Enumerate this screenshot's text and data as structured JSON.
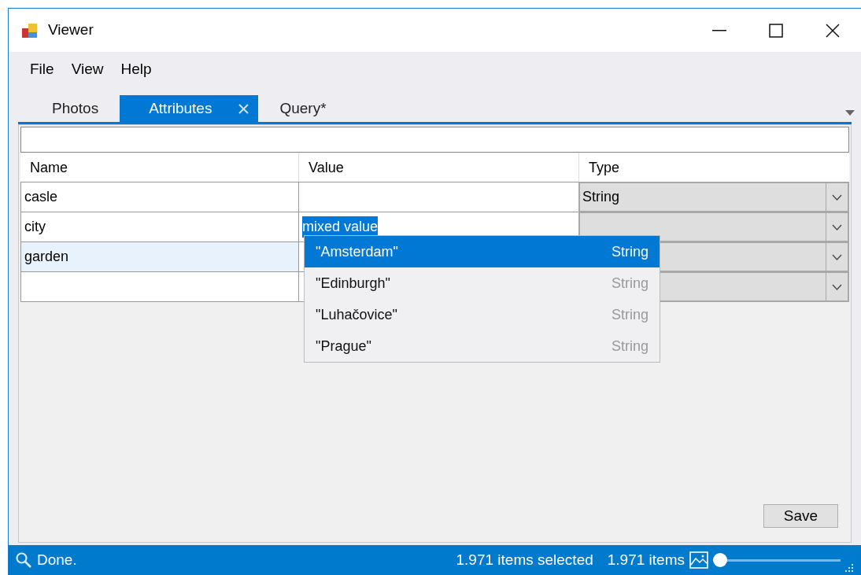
{
  "window": {
    "title": "Viewer"
  },
  "menu": [
    "File",
    "View",
    "Help"
  ],
  "tabs": [
    {
      "label": "Photos",
      "selected": false
    },
    {
      "label": "Attributes",
      "selected": true
    },
    {
      "label": "Query*",
      "selected": false
    }
  ],
  "grid": {
    "columns": [
      "Name",
      "Value",
      "Type"
    ],
    "rows": [
      {
        "name": "casle",
        "type": "String",
        "selected": false
      },
      {
        "name": "city",
        "value": "mixed value",
        "editing": true,
        "selected": false
      },
      {
        "name": "garden",
        "selected": true
      },
      {
        "selected": false
      }
    ]
  },
  "dropdown": {
    "items": [
      {
        "value": "\"Amsterdam\"",
        "type": "String",
        "selected": true
      },
      {
        "value": "\"Edinburgh\"",
        "type": "String",
        "selected": false
      },
      {
        "value": "\"Luhačovice\"",
        "type": "String",
        "selected": false
      },
      {
        "value": "\"Prague\"",
        "type": "String",
        "selected": false
      }
    ]
  },
  "save_button": "Save",
  "status_bar": {
    "text": "Done.",
    "selected_count": "1.971 items selected",
    "item_count": "1.971 items",
    "zoom": {
      "level": 0.02
    }
  }
}
